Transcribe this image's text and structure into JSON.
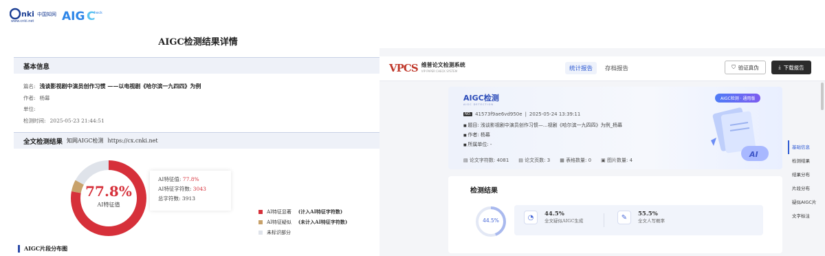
{
  "cnki": {
    "logo": {
      "brand": "CNKI中国知网",
      "url": "www.cnki.net",
      "aigc": "AIGC",
      "check": "heck"
    },
    "page_title": "AIGC检测结果详情",
    "basic_info": {
      "section_title": "基本信息",
      "title_label": "篇名:",
      "title_value": "浅谈影视剧中演员创作习惯 ——以电视剧《哈尔滨一九四四》为例",
      "author_label": "作者:",
      "author_value": "杨幕",
      "unit_label": "单位:",
      "unit_value": "",
      "time_label": "检测时间:",
      "time_value": "2025-05-23 21:44:51"
    },
    "full_result": {
      "section_title": "全文检测结果",
      "sub_title": "知网AIGC检测",
      "sub_url": "https://cx.cnki.net",
      "donut_pct": "77.8%",
      "donut_label": "AI特征值",
      "donut_fractions": [
        0.778,
        0.05,
        0.172
      ],
      "card": {
        "ai_value_label": "AI特征值:",
        "ai_value": "77.8%",
        "ai_chars_label": "AI特征字符数:",
        "ai_chars": "3043",
        "total_label": "总字符数:",
        "total": "3913"
      },
      "legend": [
        {
          "label": "AI特征显著",
          "note": "(计入AI特征字符数)",
          "color": "#d6303a"
        },
        {
          "label": "AI特征疑似",
          "note": "(未计入AI特征字符数)",
          "color": "#c8a26b"
        },
        {
          "label": "未标识部分",
          "note": "",
          "color": "#dfe3ea"
        }
      ]
    },
    "fragment_title": "AIGC片段分布图"
  },
  "vpcs": {
    "logo_mark": "VPCS",
    "logo_cn": "维普论文检测系统",
    "logo_en": "VIP PAPER CHECK SYSTEM",
    "tabs": [
      {
        "label": "统计报告"
      },
      {
        "label": "存档报告"
      }
    ],
    "btn_verify": "验证真伪",
    "btn_download": "下载报告",
    "hero": {
      "logo": "AIGC检测",
      "logo_sub": "AIGC DETECTION",
      "tag": "AIGC检测 · 通用版",
      "no_badge": "NO.",
      "report_id": "41573f9ae6vd950e",
      "datetime": "2025-05-24 13:39:11",
      "title": "题目: 浅谈影视剧中演员创作习惯—...视剧《哈尔滨一九四四》为例_杨幕",
      "author": "作者: 杨幕",
      "unit": "所属单位: -",
      "counts": [
        {
          "label": "论文字符数:",
          "value": "4081"
        },
        {
          "label": "论文页数:",
          "value": "3"
        },
        {
          "label": "表格数量:",
          "value": "0"
        },
        {
          "label": "图片数量:",
          "value": "4"
        }
      ]
    },
    "result": {
      "heading": "检测结果",
      "ring_pct": "44.5%",
      "ring_fraction": 0.445,
      "ai_pct": "44.5%",
      "ai_desc": "全文疑似AIGC生成",
      "human_pct": "55.5%",
      "human_desc": "全文人写概率"
    },
    "side_nav": [
      {
        "label": "基础信息"
      },
      {
        "label": "检测结果"
      },
      {
        "label": "结果分布"
      },
      {
        "label": "片段分布"
      },
      {
        "label": "疑似AIGC片"
      },
      {
        "label": "文字标注"
      }
    ]
  }
}
